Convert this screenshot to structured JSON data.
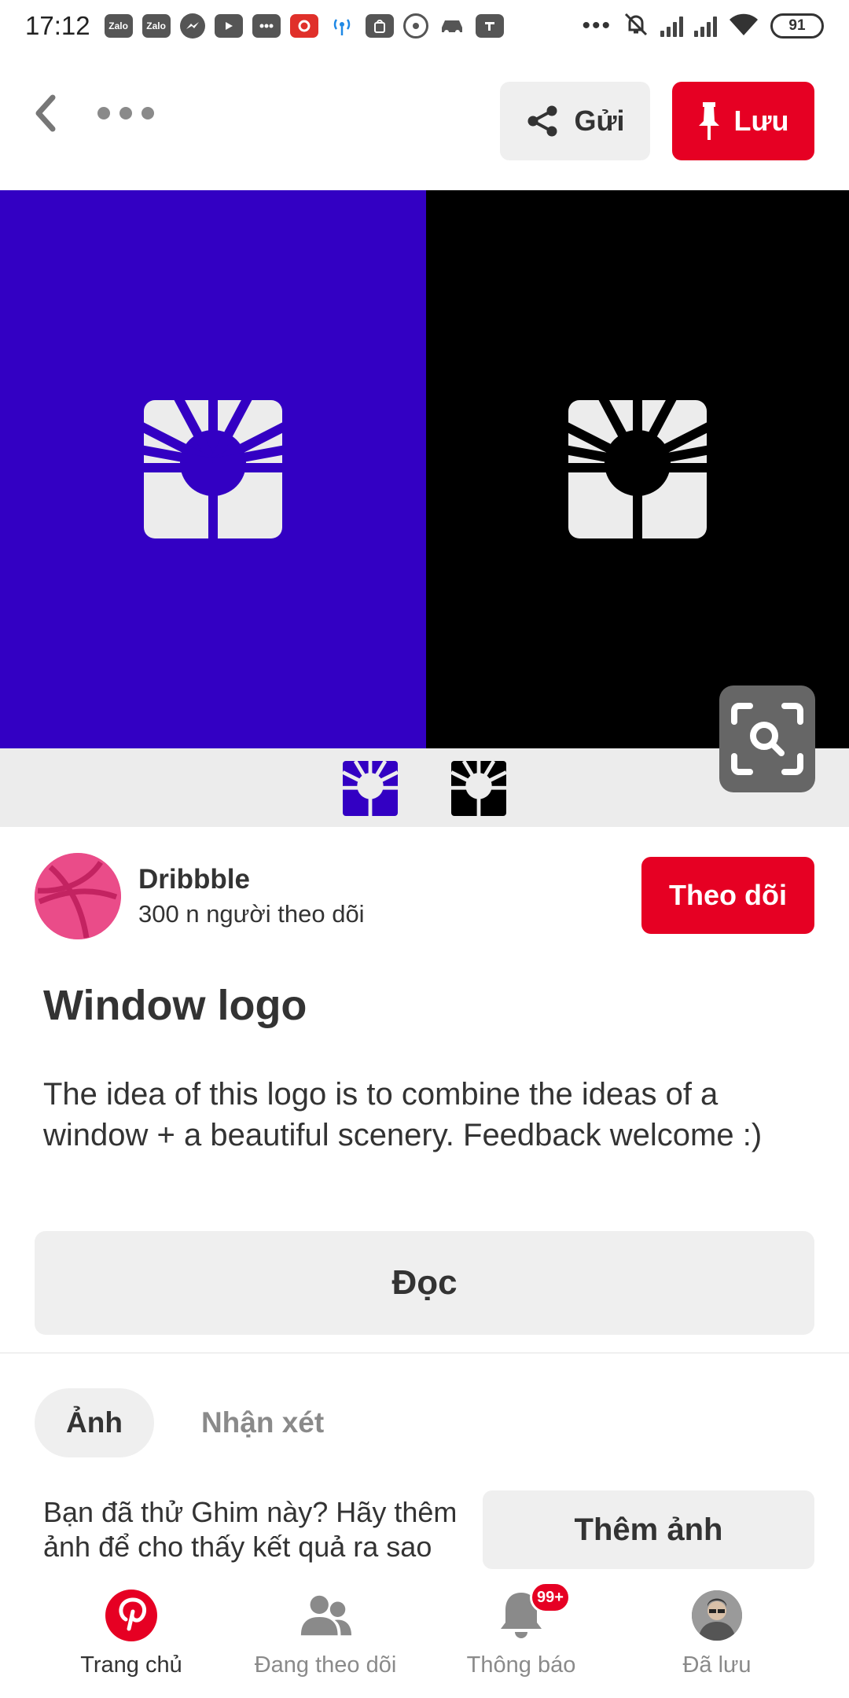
{
  "status_bar": {
    "time": "17:12",
    "icons": [
      "zalo-icon",
      "zalo-icon",
      "messenger-icon",
      "youtube-icon",
      "sms-icon",
      "app-icon",
      "hotspot-icon",
      "shopee-icon",
      "chrome-icon",
      "car-icon",
      "tiki-icon"
    ],
    "zalo_label": "Zalo",
    "more": "•••",
    "battery": "91"
  },
  "topbar": {
    "send_label": "Gửi",
    "save_label": "Lưu"
  },
  "pin": {
    "colors": {
      "left_panel": "#3300c3",
      "right_panel": "#000000",
      "brand": "#e60023"
    }
  },
  "creator": {
    "name": "Dribbble",
    "followers": "300 n người theo dõi",
    "follow_label": "Theo dõi"
  },
  "content": {
    "title": "Window logo",
    "description": "The idea of this logo is to combine the ideas of a window + a beautiful scenery. Feedback welcome :)",
    "read_label": "Đọc"
  },
  "tabs": [
    {
      "label": "Ảnh",
      "active": true
    },
    {
      "label": "Nhận xét",
      "active": false
    }
  ],
  "tried": {
    "prompt": "Bạn đã thử Ghim này? Hãy thêm ảnh để cho thấy kết quả ra sao",
    "add_photo_label": "Thêm ảnh"
  },
  "bottom_nav": [
    {
      "label": "Trang chủ",
      "icon": "pinterest-icon",
      "active": true
    },
    {
      "label": "Đang theo dõi",
      "icon": "people-icon",
      "active": false
    },
    {
      "label": "Thông báo",
      "icon": "bell-icon",
      "active": false,
      "badge": "99+"
    },
    {
      "label": "Đã lưu",
      "icon": "avatar",
      "active": false
    }
  ]
}
